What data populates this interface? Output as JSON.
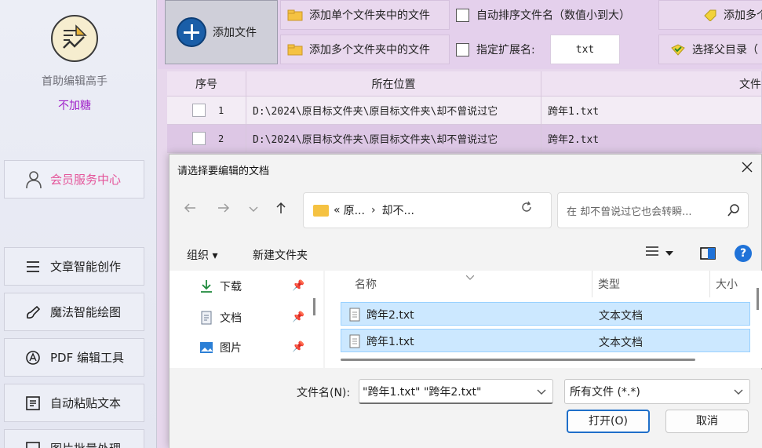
{
  "sidebar": {
    "app_name": "首助编辑高手",
    "subtitle": "不加糖",
    "member_button": "会员服务中心",
    "items": [
      {
        "label": "文章智能创作",
        "icon": "list-icon"
      },
      {
        "label": "魔法智能绘图",
        "icon": "brush-icon"
      },
      {
        "label": "PDF 编辑工具",
        "icon": "pdf-icon"
      },
      {
        "label": "自动粘贴文本",
        "icon": "clipboard-icon"
      },
      {
        "label": "图片批量处理",
        "icon": "image-icon"
      }
    ]
  },
  "toolbar": {
    "add_file": "添加文件",
    "add_single_folder": "添加单个文件夹中的文件",
    "add_multi_folder": "添加多个文件夹中的文件",
    "auto_sort": "自动排序文件名（数值小到大）",
    "specify_ext": "指定扩展名:",
    "ext_value": "txt",
    "add_more": "添加多个",
    "select_parent": "选择父目录（"
  },
  "table": {
    "headers": [
      "序号",
      "所在位置",
      "文件"
    ],
    "rows": [
      {
        "num": "1",
        "path": "D:\\2024\\原目标文件夹\\原目标文件夹\\却不曾说过它",
        "name": "跨年1.txt"
      },
      {
        "num": "2",
        "path": "D:\\2024\\原目标文件夹\\原目标文件夹\\却不曾说过它",
        "name": "跨年2.txt"
      }
    ]
  },
  "dialog": {
    "title": "请选择要编辑的文档",
    "address": {
      "prefix": "«",
      "seg1": "原...",
      "sep": "›",
      "seg2": "却不..."
    },
    "search_placeholder": "在 却不曾说过它也会转瞬...",
    "organize": "组织 ▾",
    "new_folder": "新建文件夹",
    "nav_items": [
      {
        "label": "下载",
        "icon": "download-icon"
      },
      {
        "label": "文档",
        "icon": "document-icon"
      },
      {
        "label": "图片",
        "icon": "picture-icon"
      }
    ],
    "columns": {
      "name": "名称",
      "type": "类型",
      "size": "大小"
    },
    "files": [
      {
        "name": "跨年2.txt",
        "type": "文本文档"
      },
      {
        "name": "跨年1.txt",
        "type": "文本文档"
      }
    ],
    "filename_label": "文件名(N):",
    "filename_value": "\"跨年1.txt\" \"跨年2.txt\"",
    "filetype_value": "所有文件 (*.*)",
    "open_button": "打开(O)",
    "cancel_button": "取消"
  },
  "colors": {
    "accent": "#1f6fc9",
    "sidebar_subtitle": "#a022c9",
    "member_text": "#e4559a",
    "toolbar_bg": "#e4d0ec",
    "selection": "#cce8ff"
  }
}
